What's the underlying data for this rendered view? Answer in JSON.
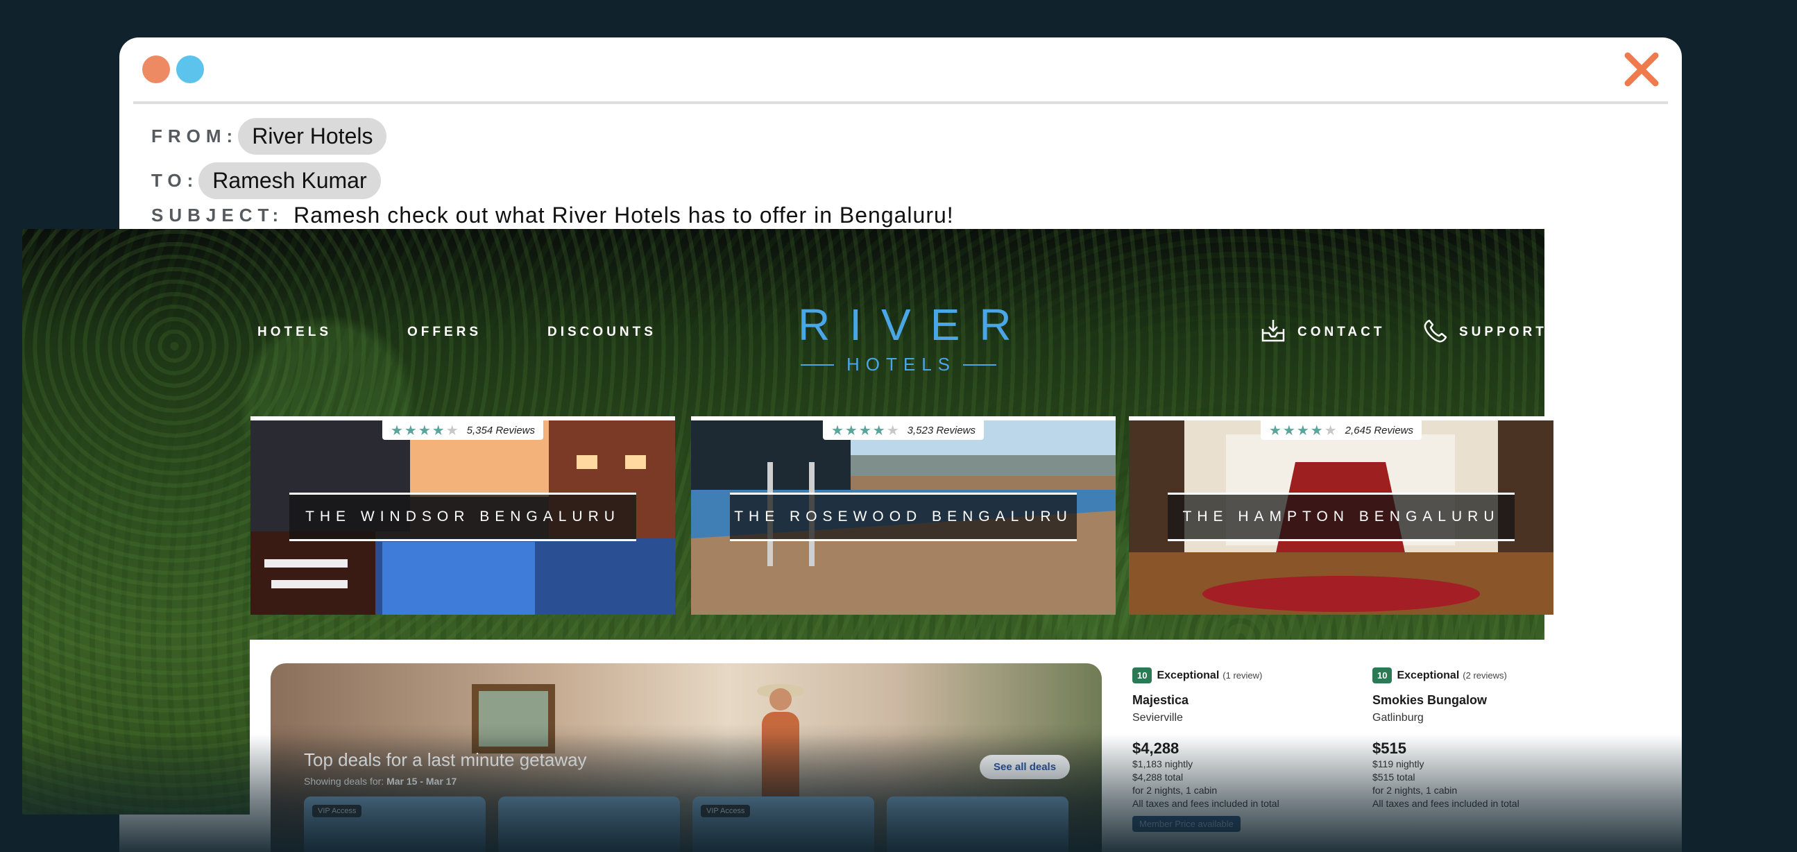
{
  "email": {
    "from_label": "FROM:",
    "from_value": "River Hotels",
    "to_label": "TO:",
    "to_value": "Ramesh Kumar",
    "subject_label": "SUBJECT:",
    "subject_value": "Ramesh check out what River Hotels has to offer in Bengaluru!"
  },
  "nav": {
    "hotels": "HOTELS",
    "offers": "OFFERS",
    "discounts": "DISCOUNTS",
    "contact": "CONTACT",
    "support": "SUPPORT"
  },
  "logo": {
    "top": "RIVER",
    "bottom": "HOTELS",
    "color": "#4aa6e6"
  },
  "hotels": [
    {
      "name": "THE WINDSOR BENGALURU",
      "reviews": "5,354 Reviews",
      "stars": 4
    },
    {
      "name": "THE ROSEWOOD BENGALURU",
      "reviews": "3,523 Reviews",
      "stars": 4
    },
    {
      "name": "THE HAMPTON BENGALURU",
      "reviews": "2,645 Reviews",
      "stars": 4
    }
  ],
  "deals": {
    "title": "Top deals for a last minute getaway",
    "showing_label": "Showing deals for:",
    "dates": "Mar 15 - Mar 17",
    "see_all": "See all deals",
    "vip_label": "VIP Access"
  },
  "listings": [
    {
      "score": "10",
      "rating_label": "Exceptional",
      "review_count": "(1 review)",
      "name": "Majestica",
      "city": "Sevierville",
      "price": "$4,288",
      "nightly": "$1,183 nightly",
      "total": "$4,288 total",
      "stay": "for 2 nights, 1 cabin",
      "taxes": "All taxes and fees included in total",
      "member": "Member Price available"
    },
    {
      "score": "10",
      "rating_label": "Exceptional",
      "review_count": "(2 reviews)",
      "name": "Smokies Bungalow",
      "city": "Gatlinburg",
      "price": "$515",
      "nightly": "$119 nightly",
      "total": "$515 total",
      "stay": "for 2 nights, 1 cabin",
      "taxes": "All taxes and fees included in total"
    }
  ],
  "colors": {
    "page_bg": "#10222b",
    "dot_orange": "#ee8a63",
    "dot_blue": "#5bc3ec",
    "close": "#ee7a4e",
    "star": "#5aa59b",
    "score": "#2c7a55"
  },
  "icons": {
    "close": "close-icon",
    "contact": "mail-tray-icon",
    "support": "phone-icon",
    "star": "star-icon"
  }
}
